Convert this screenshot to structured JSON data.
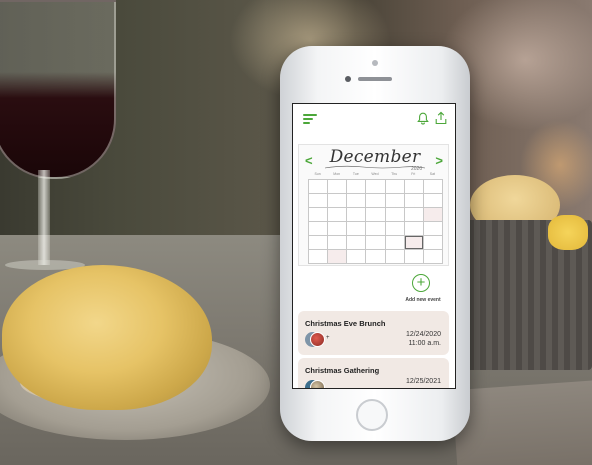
{
  "app": {
    "calendar": {
      "month": "December",
      "year": "2020",
      "prev_glyph": "<",
      "next_glyph": ">",
      "weekdays": [
        "Sun",
        "Mon",
        "Tue",
        "Wed",
        "Thu",
        "Fri",
        "Sat"
      ]
    },
    "add_event": {
      "icon": "+",
      "label": "Add new event"
    },
    "events": [
      {
        "title": "Christmas Eve Brunch",
        "date": "12/24/2020",
        "time": "11:00 a.m.",
        "guests_more": "+"
      },
      {
        "title": "Christmas Gathering",
        "date": "12/25/2021",
        "time": ""
      }
    ]
  },
  "icons": {
    "menu": "hamburger-menu-icon",
    "bell": "bell-icon",
    "share": "share-upload-icon"
  },
  "colors": {
    "accent": "#4ca73a",
    "event_card": "#f1e9e4"
  }
}
